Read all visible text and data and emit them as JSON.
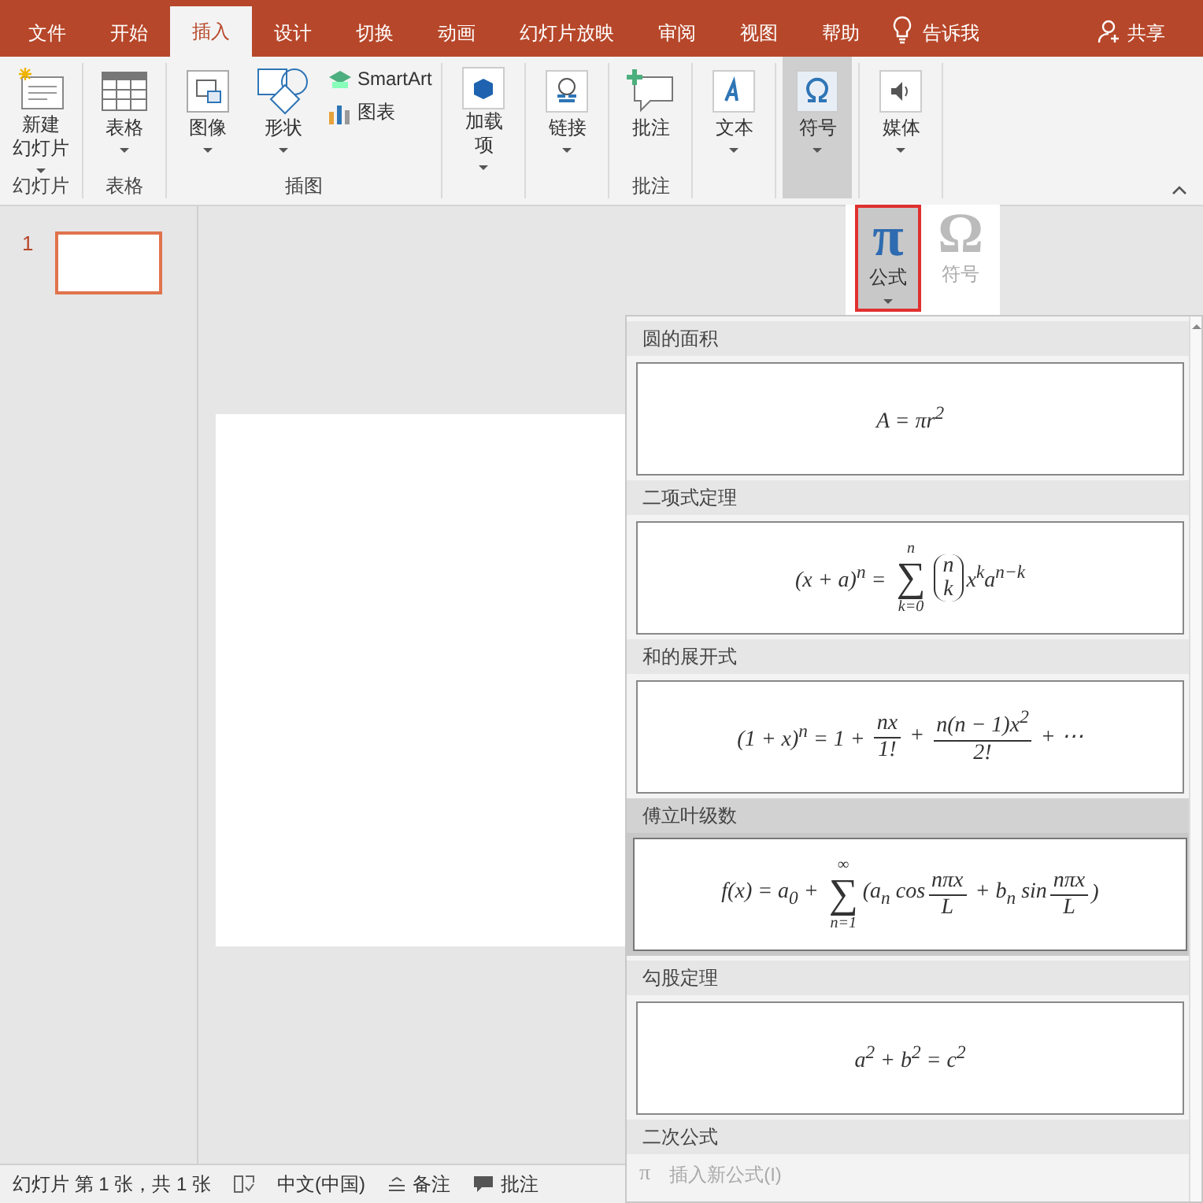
{
  "tabs": [
    {
      "label": "文件",
      "selected": false
    },
    {
      "label": "开始",
      "selected": false
    },
    {
      "label": "插入",
      "selected": true
    },
    {
      "label": "设计",
      "selected": false
    },
    {
      "label": "切换",
      "selected": false
    },
    {
      "label": "动画",
      "selected": false
    },
    {
      "label": "幻灯片放映",
      "selected": false
    },
    {
      "label": "审阅",
      "selected": false
    },
    {
      "label": "视图",
      "selected": false
    },
    {
      "label": "帮助",
      "selected": false
    }
  ],
  "tell_me": "告诉我",
  "share": "共享",
  "ribbon": {
    "groups": [
      {
        "label": "幻灯片",
        "buttons": [
          {
            "lines": [
              "新建",
              "幻灯片"
            ],
            "dropdown": true,
            "selected": false
          }
        ]
      },
      {
        "label": "表格",
        "buttons": [
          {
            "lines": [
              "表格"
            ],
            "dropdown": true,
            "selected": false
          }
        ]
      },
      {
        "label": "插图",
        "buttons": [
          {
            "lines": [
              "图像"
            ],
            "dropdown": true,
            "selected": false
          },
          {
            "lines": [
              "形状"
            ],
            "dropdown": true,
            "selected": false
          }
        ],
        "small_buttons": [
          {
            "label": "SmartArt"
          },
          {
            "label": "图表"
          }
        ]
      },
      {
        "buttons": [
          {
            "lines": [
              "加载",
              "项"
            ],
            "dropdown": true,
            "selected": false
          }
        ]
      },
      {
        "buttons": [
          {
            "lines": [
              "链接"
            ],
            "dropdown": true,
            "selected": false
          }
        ]
      },
      {
        "label": "批注",
        "buttons": [
          {
            "lines": [
              "批注"
            ],
            "dropdown": false,
            "selected": false
          }
        ]
      },
      {
        "buttons": [
          {
            "lines": [
              "文本"
            ],
            "dropdown": true,
            "selected": false
          }
        ]
      },
      {
        "buttons": [
          {
            "lines": [
              "符号"
            ],
            "dropdown": true,
            "selected": true
          }
        ]
      },
      {
        "buttons": [
          {
            "lines": [
              "媒体"
            ],
            "dropdown": true,
            "selected": false
          }
        ]
      }
    ]
  },
  "slides": [
    {
      "number": "1",
      "selected": true
    }
  ],
  "symbol_menu": [
    {
      "glyph": "π",
      "label": "公式",
      "dropdown": true,
      "selected": true,
      "disabled": false
    },
    {
      "glyph": "Ω",
      "label": "符号",
      "dropdown": false,
      "selected": false,
      "disabled": true
    }
  ],
  "equations": [
    {
      "title": "圆的面积",
      "selected": false,
      "formula": [
        {
          "kind": "text",
          "text": "A = πr$^{2}$"
        }
      ]
    },
    {
      "title": "二项式定理",
      "selected": false,
      "formula": [
        {
          "kind": "text",
          "text": "(x + a)$^{n}$ = "
        },
        {
          "kind": "sum",
          "symbol": "∑",
          "upper": "n",
          "lower": "k=0"
        },
        {
          "kind": "binom",
          "top": "n",
          "bottom": "k"
        },
        {
          "kind": "text",
          "text": "x$^{k}$a$^{n−k}$"
        }
      ]
    },
    {
      "title": "和的展开式",
      "selected": false,
      "formula": [
        {
          "kind": "text",
          "text": "(1 + x)$^{n}$ = 1 + "
        },
        {
          "kind": "frac",
          "num": "nx",
          "den": "1!"
        },
        {
          "kind": "text",
          "text": " + "
        },
        {
          "kind": "frac",
          "num": "n(n − 1)x$^{2}$",
          "den": "2!"
        },
        {
          "kind": "text",
          "text": " + ⋯"
        }
      ]
    },
    {
      "title": "傅立叶级数",
      "selected": true,
      "formula": [
        {
          "kind": "text",
          "text": "f(x) = a$_{0}$ + "
        },
        {
          "kind": "sum",
          "symbol": "∑",
          "upper": "∞",
          "lower": "n=1"
        },
        {
          "kind": "text",
          "text": "(a$_{n}$ cos"
        },
        {
          "kind": "frac",
          "num": "nπx",
          "den": "L"
        },
        {
          "kind": "text",
          "text": " + b$_{n}$ sin"
        },
        {
          "kind": "frac",
          "num": "nπx",
          "den": "L"
        },
        {
          "kind": "text",
          "text": ")"
        }
      ]
    },
    {
      "title": "勾股定理",
      "selected": false,
      "formula": [
        {
          "kind": "text",
          "text": "a$^{2}$ + b$^{2}$ = c$^{2}$"
        }
      ]
    },
    {
      "title": "二次公式",
      "selected": false
    }
  ],
  "insert_new": {
    "glyph": "π",
    "label": "插入新公式(I)"
  },
  "status_bar": {
    "slide_info": "幻灯片 第 1 张，共 1 张",
    "language": "中文(中国)",
    "notes": "备注",
    "comments": "批注"
  }
}
